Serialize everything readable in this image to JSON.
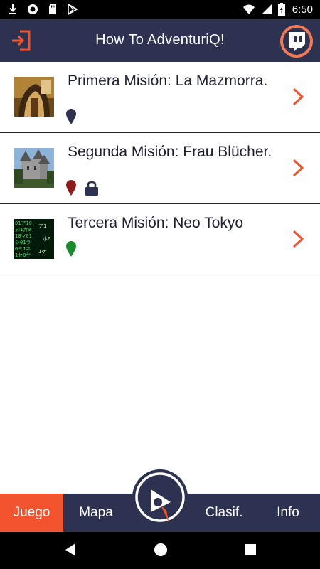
{
  "status_bar": {
    "time": "6:50",
    "icons": [
      "download-icon",
      "record-icon",
      "sd-card-icon",
      "play-store-icon",
      "wifi-icon",
      "signal-icon",
      "battery-icon"
    ]
  },
  "app_bar": {
    "title": "How To AdventuriQ!",
    "left_icon": "logout-icon",
    "right_icon": "twitch-icon"
  },
  "missions": [
    {
      "title": "Primera Misión: La Mazmorra.",
      "marker_color": "#2d3250",
      "locked": false,
      "thumb": "dungeon-thumbnail"
    },
    {
      "title": "Segunda Misión: Frau Blücher.",
      "marker_color": "#8b1c1c",
      "locked": true,
      "thumb": "castle-thumbnail"
    },
    {
      "title": "Tercera Misión: Neo Tokyo",
      "marker_color": "#1a8a2e",
      "locked": false,
      "thumb": "matrix-thumbnail"
    }
  ],
  "bottom_nav": {
    "tabs": [
      {
        "label": "Juego",
        "active": true
      },
      {
        "label": "Mapa",
        "active": false
      },
      {
        "label": "Clasif.",
        "active": false
      },
      {
        "label": "Info",
        "active": false
      }
    ],
    "center_icon": "adventuriq-logo-icon"
  },
  "colors": {
    "primary": "#2d3250",
    "accent": "#f0532d",
    "chevron": "#f0532d"
  }
}
